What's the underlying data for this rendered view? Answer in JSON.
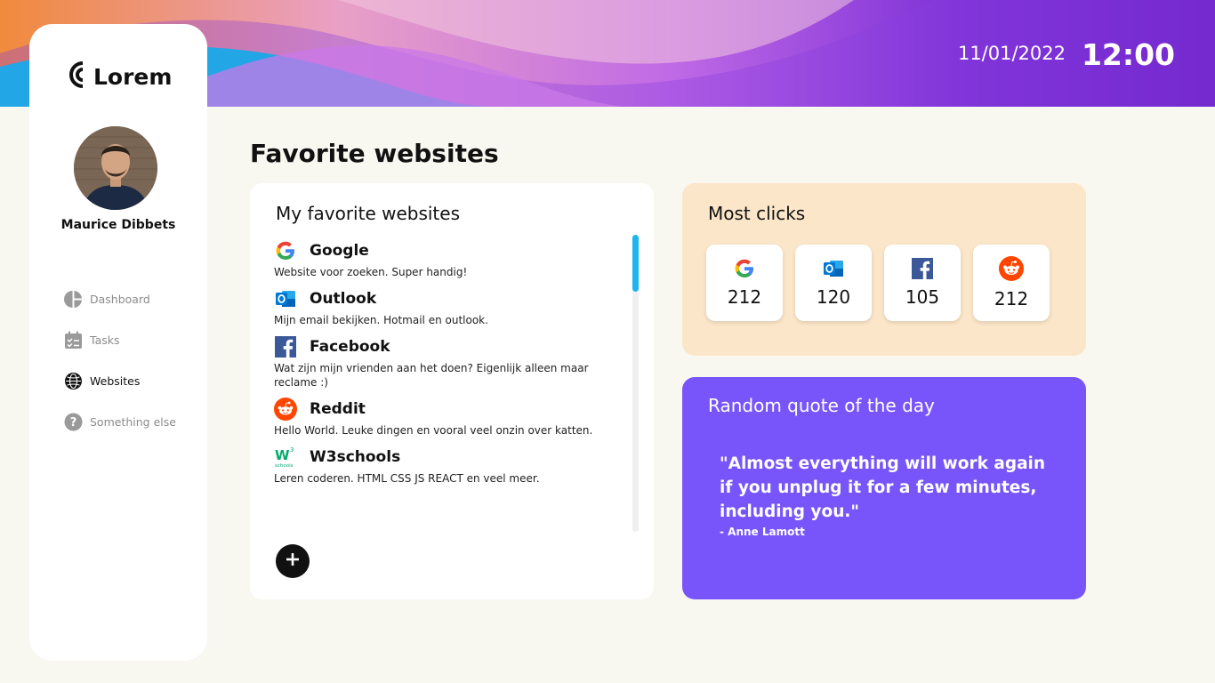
{
  "header": {
    "date": "11/01/2022",
    "time": "12:00"
  },
  "sidebar": {
    "logo": "Lorem",
    "user_name": "Maurice Dibbets",
    "nav": [
      {
        "label": "Dashboard",
        "icon": "pie-chart-icon"
      },
      {
        "label": "Tasks",
        "icon": "calendar-check-icon"
      },
      {
        "label": "Websites",
        "icon": "globe-icon",
        "active": true
      },
      {
        "label": "Something else",
        "icon": "question-icon"
      }
    ]
  },
  "main": {
    "title": "Favorite websites",
    "favorites": {
      "title": "My favorite websites",
      "sites": [
        {
          "name": "Google",
          "description": "Website voor zoeken. Super handig!",
          "icon": "google-icon"
        },
        {
          "name": "Outlook",
          "description": "Mijn email bekijken. Hotmail en outlook.",
          "icon": "outlook-icon"
        },
        {
          "name": "Facebook",
          "description": "Wat zijn mijn vrienden aan het doen? Eigenlijk alleen maar reclame :)",
          "icon": "facebook-icon"
        },
        {
          "name": "Reddit",
          "description": "Hello World. Leuke dingen en vooral veel onzin over katten.",
          "icon": "reddit-icon"
        },
        {
          "name": "W3schools",
          "description": "Leren coderen. HTML CSS JS REACT en veel meer.",
          "icon": "w3schools-icon"
        }
      ],
      "add_icon": "plus-icon"
    },
    "clicks": {
      "title": "Most clicks",
      "items": [
        {
          "icon": "google-icon",
          "count": "212"
        },
        {
          "icon": "outlook-icon",
          "count": "120"
        },
        {
          "icon": "facebook-icon",
          "count": "105"
        },
        {
          "icon": "reddit-icon",
          "count": "212"
        }
      ]
    },
    "quote": {
      "title": "Random quote of the day",
      "text": "\"Almost everything will work again if you unplug it for a few minutes, including you.\"",
      "author": "- Anne Lamott"
    }
  },
  "colors": {
    "background": "#f8f7f0",
    "accent_blue": "#1eb4ec",
    "clicks_panel": "#fce6c9",
    "quote_panel": "#7855fa"
  }
}
